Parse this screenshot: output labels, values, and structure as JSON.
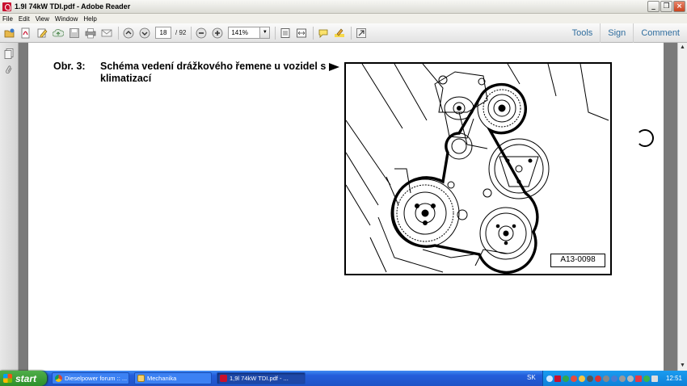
{
  "window": {
    "title": "1.9l 74kW TDI.pdf - Adobe Reader"
  },
  "menu": [
    "File",
    "Edit",
    "View",
    "Window",
    "Help"
  ],
  "toolbar": {
    "page_current": "18",
    "page_total": "/ 92",
    "zoom": "141%",
    "right_buttons": [
      "Tools",
      "Sign",
      "Comment"
    ]
  },
  "document": {
    "figure_label": "Obr. 3:",
    "figure_caption": "Schéma vedení drážkového řemene u vozidel s klimatizací",
    "figure_code": "A13-0098"
  },
  "taskbar": {
    "start_label": "start",
    "tasks": [
      {
        "label": "Dieselpower forum :: ...",
        "icon": "chrome-icon"
      },
      {
        "label": "Mechanika",
        "icon": "folder-icon"
      },
      {
        "label": "1,9l 74kW TDI.pdf - ...",
        "icon": "pdf-icon"
      }
    ],
    "language": "SK",
    "clock": "12:51"
  },
  "colors": {
    "accent_link": "#2f6d9e",
    "taskbar_blue": "#245edb",
    "start_green": "#2d8f2a",
    "doc_background": "#7a7a7a"
  }
}
